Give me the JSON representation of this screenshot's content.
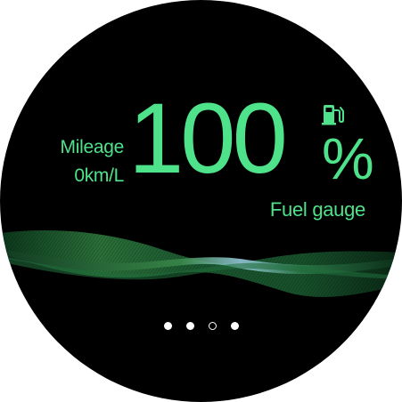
{
  "colors": {
    "accent": "#4ee28a",
    "background": "#000000",
    "indicator": "#ffffff"
  },
  "mileage": {
    "label": "Mileage",
    "value": "0km/L"
  },
  "fuel": {
    "value": "100",
    "unit": "%",
    "label": "Fuel gauge",
    "icon": "fuel-pump-icon",
    "level_percent": 100
  },
  "pager": {
    "total_pages": 4,
    "current_page": 3
  }
}
